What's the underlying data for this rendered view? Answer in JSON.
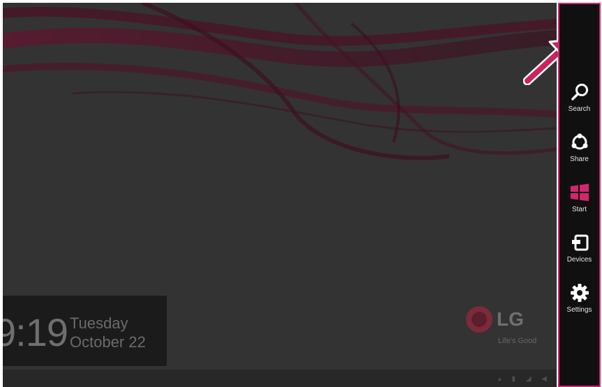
{
  "lock_screen": {
    "clock": {
      "time": "9:19",
      "day": "Tuesday",
      "date": "October 22"
    },
    "logo": {
      "brand": "LG",
      "tagline": "Life's Good"
    }
  },
  "charms": [
    {
      "label": "Search",
      "icon": "search-icon"
    },
    {
      "label": "Share",
      "icon": "share-icon"
    },
    {
      "label": "Start",
      "icon": "windows-start-icon"
    },
    {
      "label": "Devices",
      "icon": "devices-icon"
    },
    {
      "label": "Settings",
      "icon": "gear-icon"
    }
  ],
  "colors": {
    "highlight": "#d3266e",
    "start_icon": "#d3266e",
    "charms_bg": "#101010",
    "desktop_bg": "#333333"
  }
}
